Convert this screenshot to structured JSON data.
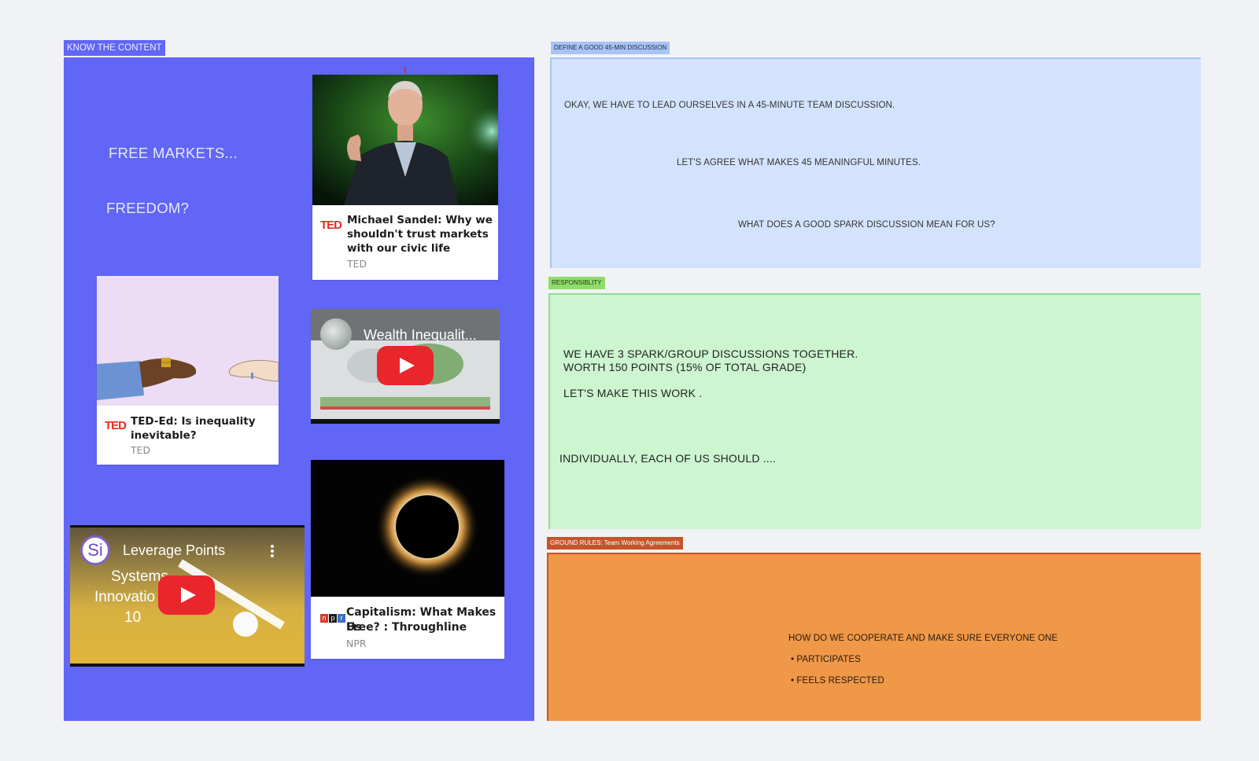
{
  "left_section": {
    "label": "KNOW THE CONTENT",
    "heading_1": "FREE MARKETS...",
    "heading_2": "FREEDOM?",
    "colors": {
      "frame": "#6166f7",
      "label_bg": "#6166f7"
    }
  },
  "cards": {
    "sandel": {
      "logo": "TED",
      "title_line1": "Michael Sandel: Why we",
      "title_line2": "shouldn't trust markets",
      "title_line3": "with our civic life",
      "source": "TED"
    },
    "inequality": {
      "logo": "TED",
      "title_line1": "TED-Ed: Is inequality",
      "title_line2": "inevitable?",
      "source": "TED"
    },
    "capitalism": {
      "logo": "npr",
      "title_line1": "Capitalism: What Makes Us",
      "title_line2": "Free? : Throughline",
      "source": "NPR"
    }
  },
  "videos": {
    "wealth": {
      "title": "Wealth Inequalit..."
    },
    "leverage": {
      "channel_initials": "Si",
      "title": "Leverage Points",
      "overlay_line1": "Systems",
      "overlay_line2": "Innovatio",
      "overlay_line3": "10"
    }
  },
  "discussion": {
    "label": "DEFINE A GOOD 45-MIN DISCUSSION",
    "line1": "OKAY, WE HAVE TO LEAD OURSELVES IN A 45-MINUTE TEAM DISCUSSION.",
    "line2": "LET'S AGREE WHAT MAKES 45 MEANINGFUL MINUTES.",
    "line3": "WHAT DOES A GOOD SPARK DISCUSSION MEAN FOR US?"
  },
  "responsibility": {
    "label": "RESPONSIBLITY",
    "line1": "WE HAVE 3 SPARK/GROUP DISCUSSIONS TOGETHER.",
    "line2": "WORTH 150 POINTS (15% OF TOTAL GRADE)",
    "line3": "LET'S MAKE THIS WORK .",
    "line4": "INDIVIDUALLY, EACH OF US SHOULD ...."
  },
  "ground_rules": {
    "label": "GROUND RULES:  Team Working Agreements",
    "question": "HOW DO WE COOPERATE AND MAKE SURE EVERYONE ONE",
    "bullet1": "• PARTICIPATES",
    "bullet2": "• FEELS RESPECTED"
  }
}
